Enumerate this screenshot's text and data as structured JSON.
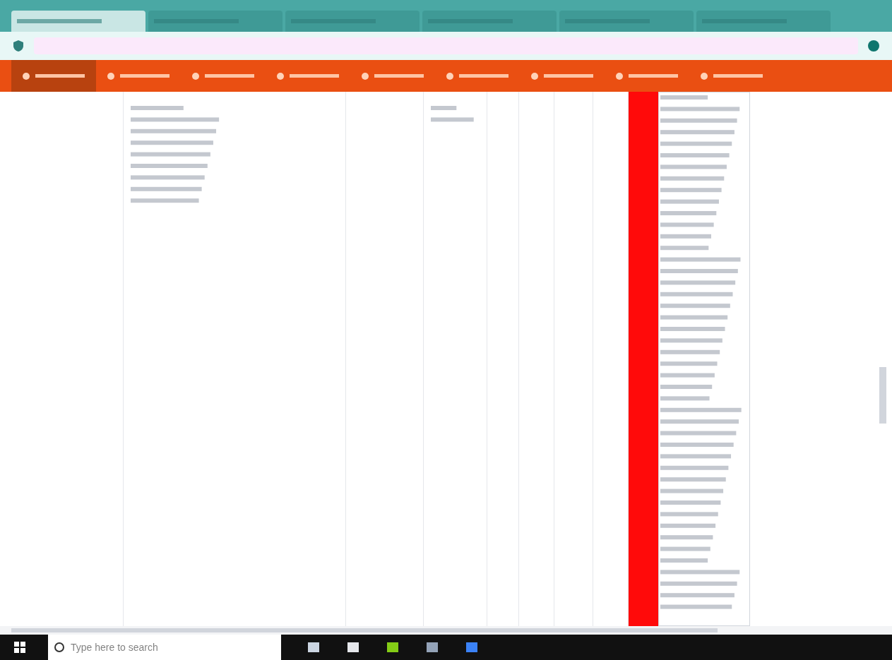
{
  "browser": {
    "tabs": [
      {
        "selected": true
      },
      {
        "selected": false
      },
      {
        "selected": false
      },
      {
        "selected": false
      },
      {
        "selected": false
      },
      {
        "selected": false
      }
    ]
  },
  "nav": {
    "items": [
      {
        "selected": true
      },
      {
        "selected": false
      },
      {
        "selected": false
      },
      {
        "selected": false
      },
      {
        "selected": false
      },
      {
        "selected": false
      },
      {
        "selected": false
      },
      {
        "selected": false
      },
      {
        "selected": false
      }
    ]
  },
  "taskbar": {
    "search": {
      "placeholder": "Type here to search"
    }
  }
}
